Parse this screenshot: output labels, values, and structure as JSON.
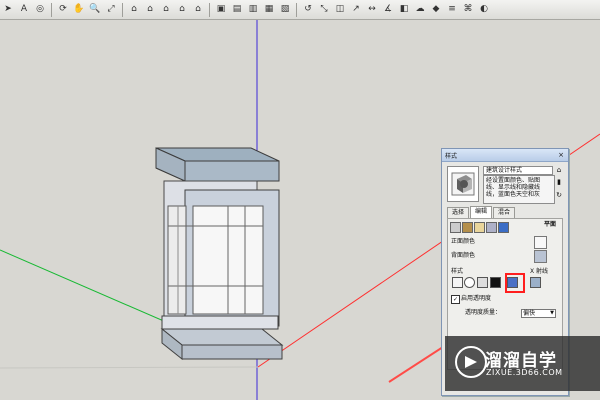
{
  "toolbar": {
    "icons": [
      "cursor-icon",
      "text-icon",
      "camera-icon",
      "rotate-icon",
      "pan-icon",
      "zoom-icon",
      "zoom-extents-icon",
      "house-view-icon",
      "house-front-icon",
      "house-right-icon",
      "house-back-icon",
      "house-left-icon",
      "cube-view-icon",
      "paint-icon",
      "eraser-icon",
      "push-pull-icon",
      "move-icon",
      "rotate-tool-icon",
      "scale-icon",
      "offset-icon",
      "follow-me-icon",
      "dimension-icon",
      "protractor-icon",
      "section-icon",
      "fog-icon",
      "component-icon",
      "layer-icon",
      "sandbox-icon",
      "shadow-icon"
    ]
  },
  "style_panel": {
    "title": "样式",
    "style_name": "建筑设计样式",
    "style_description": "经设置面颜色、贴图\n线、显示线和隐藏线\n线，蓝面色天空和灰",
    "tabs": [
      {
        "label": "选择",
        "active": false
      },
      {
        "label": "编辑",
        "active": true
      },
      {
        "label": "混合",
        "active": false
      }
    ],
    "sections": {
      "plane_label": "平面",
      "front_color_label": "正面颜色",
      "back_color_label": "背面颜色",
      "style_label": "样式",
      "x_ray_label": "X 射线",
      "transparency_label": "启用透明度",
      "transparency_quality_label": "透明度质量：",
      "transparency_quality_value": "偏快"
    },
    "colors": {
      "front": "#f8f8f8",
      "back": "#b9c3d3",
      "highlight": "#ff1e1e"
    }
  },
  "watermark": {
    "brand": "溜溜自学",
    "site": "ZIXUE.3D66.COM"
  }
}
